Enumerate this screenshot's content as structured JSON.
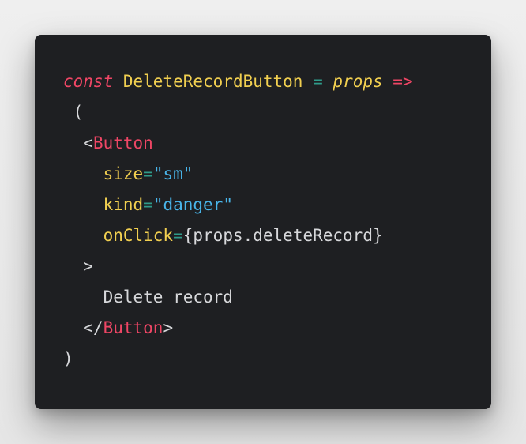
{
  "code": {
    "line1": {
      "keyword": "const",
      "name": "DeleteRecordButton",
      "equals": "=",
      "param": "props",
      "arrow": "=>"
    },
    "line2": {
      "open_paren": "("
    },
    "line3": {
      "lt": "<",
      "tag": "Button"
    },
    "line4": {
      "attr": "size",
      "equals": "=",
      "value": "\"sm\""
    },
    "line5": {
      "attr": "kind",
      "equals": "=",
      "value": "\"danger\""
    },
    "line6": {
      "attr": "onClick",
      "equals": "=",
      "expression": "{props.deleteRecord}"
    },
    "line7": {
      "gt": ">"
    },
    "line8": {
      "text": "Delete record"
    },
    "line9": {
      "close_open": "</",
      "tag": "Button",
      "close_end": ">"
    },
    "line10": {
      "close_paren": ")"
    }
  },
  "colors": {
    "background": "#1e1f22",
    "keyword": "#ef4665",
    "identifier": "#f1cf50",
    "operator": "#2f9b8a",
    "string": "#49b5ea",
    "text": "#d7d8db"
  }
}
